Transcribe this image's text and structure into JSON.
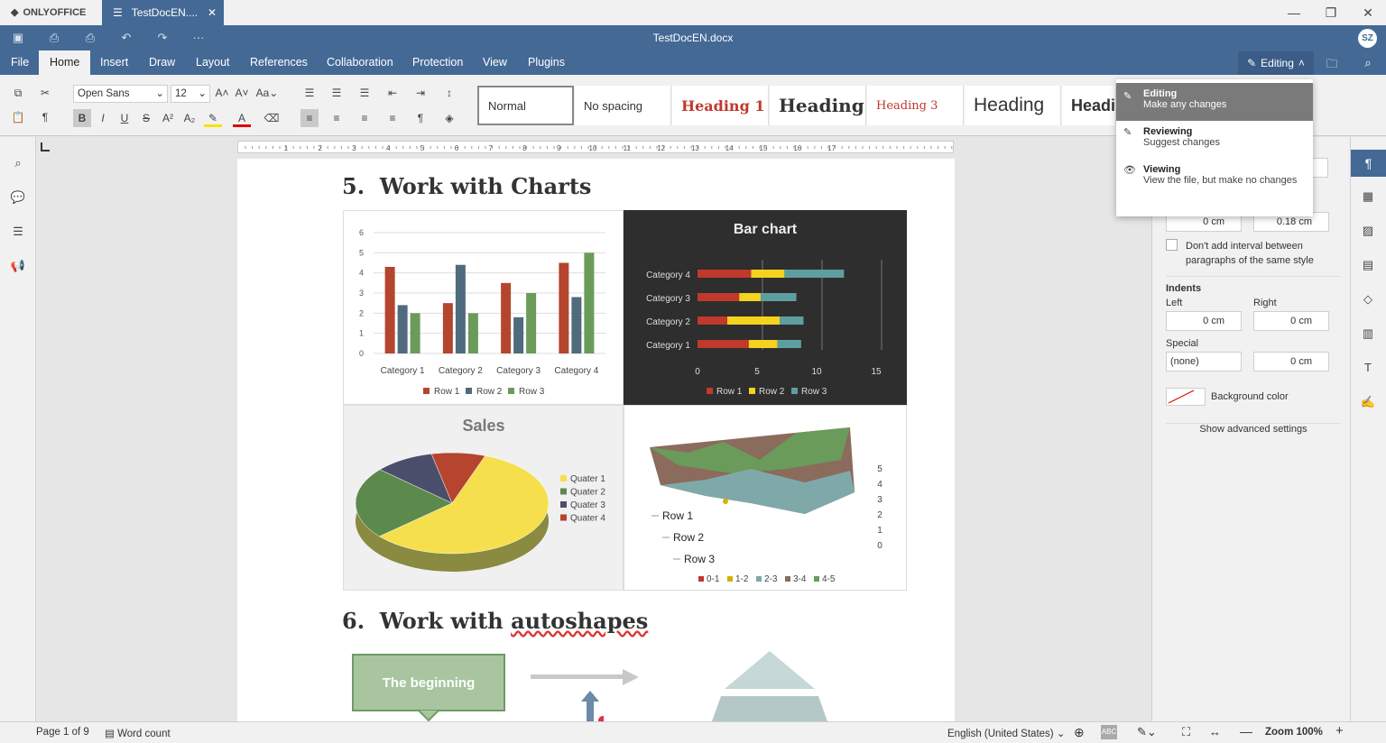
{
  "app": {
    "logo": "ONLYOFFICE",
    "tab": "TestDocEN....",
    "title": "TestDocEN.docx",
    "avatar": "SZ"
  },
  "menu": [
    "File",
    "Home",
    "Insert",
    "Draw",
    "Layout",
    "References",
    "Collaboration",
    "Protection",
    "View",
    "Plugins"
  ],
  "editing_button": "Editing",
  "font": {
    "name": "Open Sans",
    "size": "12"
  },
  "styles": [
    "Normal",
    "No spacing",
    "Heading 1",
    "Heading",
    "Heading 3",
    "Heading",
    "Headi"
  ],
  "mode_menu": [
    {
      "title": "Editing",
      "desc": "Make any changes"
    },
    {
      "title": "Reviewing",
      "desc": "Suggest changes"
    },
    {
      "title": "Viewing",
      "desc": "View the file, but make no changes"
    }
  ],
  "doc": {
    "heading5": {
      "num": "5.",
      "text": "Work with Charts"
    },
    "heading6": {
      "num": "6.",
      "text_a": "Work with ",
      "text_b": "autoshapes"
    },
    "shape_label": "The beginning"
  },
  "chart_data": [
    {
      "type": "bar",
      "categories": [
        "Category 1",
        "Category 2",
        "Category 3",
        "Category 4"
      ],
      "series": [
        {
          "name": "Row 1",
          "values": [
            4.3,
            2.5,
            3.5,
            4.5
          ]
        },
        {
          "name": "Row 2",
          "values": [
            2.4,
            4.4,
            1.8,
            2.8
          ]
        },
        {
          "name": "Row 3",
          "values": [
            2,
            2,
            3,
            5
          ]
        }
      ],
      "yticks": [
        "0",
        "1",
        "2",
        "3",
        "4",
        "5",
        "6"
      ],
      "ylim": [
        0,
        6
      ],
      "colors": [
        "#b5452e",
        "#4f6b7d",
        "#6a9b5b"
      ]
    },
    {
      "type": "bar",
      "title": "Bar chart",
      "orientation": "horizontal",
      "stacked": true,
      "categories": [
        "Category 1",
        "Category 2",
        "Category 3",
        "Category 4"
      ],
      "series": [
        {
          "name": "Row 1",
          "values": [
            4.3,
            2.5,
            3.5,
            4.5
          ]
        },
        {
          "name": "Row 2",
          "values": [
            2.4,
            4.4,
            1.8,
            2.8
          ]
        },
        {
          "name": "Row 3",
          "values": [
            2,
            2,
            3,
            5
          ]
        }
      ],
      "xticks": [
        "0",
        "5",
        "10",
        "15"
      ],
      "xlim": [
        0,
        15
      ],
      "colors": [
        "#c0392b",
        "#f5d21f",
        "#5f9ea0"
      ]
    },
    {
      "type": "pie",
      "title": "Sales",
      "labels": [
        "Quater 1",
        "Quater 2",
        "Quater 3",
        "Quater 4"
      ],
      "values": [
        58,
        23,
        10,
        9
      ],
      "colors": [
        "#f5df4d",
        "#5c8a4c",
        "#4b4e6b",
        "#b5452e"
      ]
    },
    {
      "type": "area",
      "rows": [
        "Row 1",
        "Row 2",
        "Row 3"
      ],
      "zticks": [
        "0",
        "1",
        "2",
        "3",
        "4",
        "5"
      ],
      "legend": [
        "0-1",
        "1-2",
        "2-3",
        "3-4",
        "4-5"
      ],
      "colors": [
        "#c0392b",
        "#d4b300",
        "#7fa9a9",
        "#8b6b5b",
        "#6a9b5b"
      ]
    }
  ],
  "right_panel": {
    "spacing_before": "0 cm",
    "spacing_after": "0.18 cm",
    "checkbox_label": "Don't add interval between paragraphs of the same style",
    "indents": "Indents",
    "left": "Left",
    "right": "Right",
    "left_val": "0 cm",
    "right_val": "0 cm",
    "special": "Special",
    "special_val": "(none)",
    "special_amount": "0 cm",
    "background_color": "Background color",
    "advanced": "Show advanced settings"
  },
  "status": {
    "page": "Page 1 of 9",
    "word_count": "Word count",
    "language": "English (United States)",
    "zoom": "Zoom 100%"
  }
}
